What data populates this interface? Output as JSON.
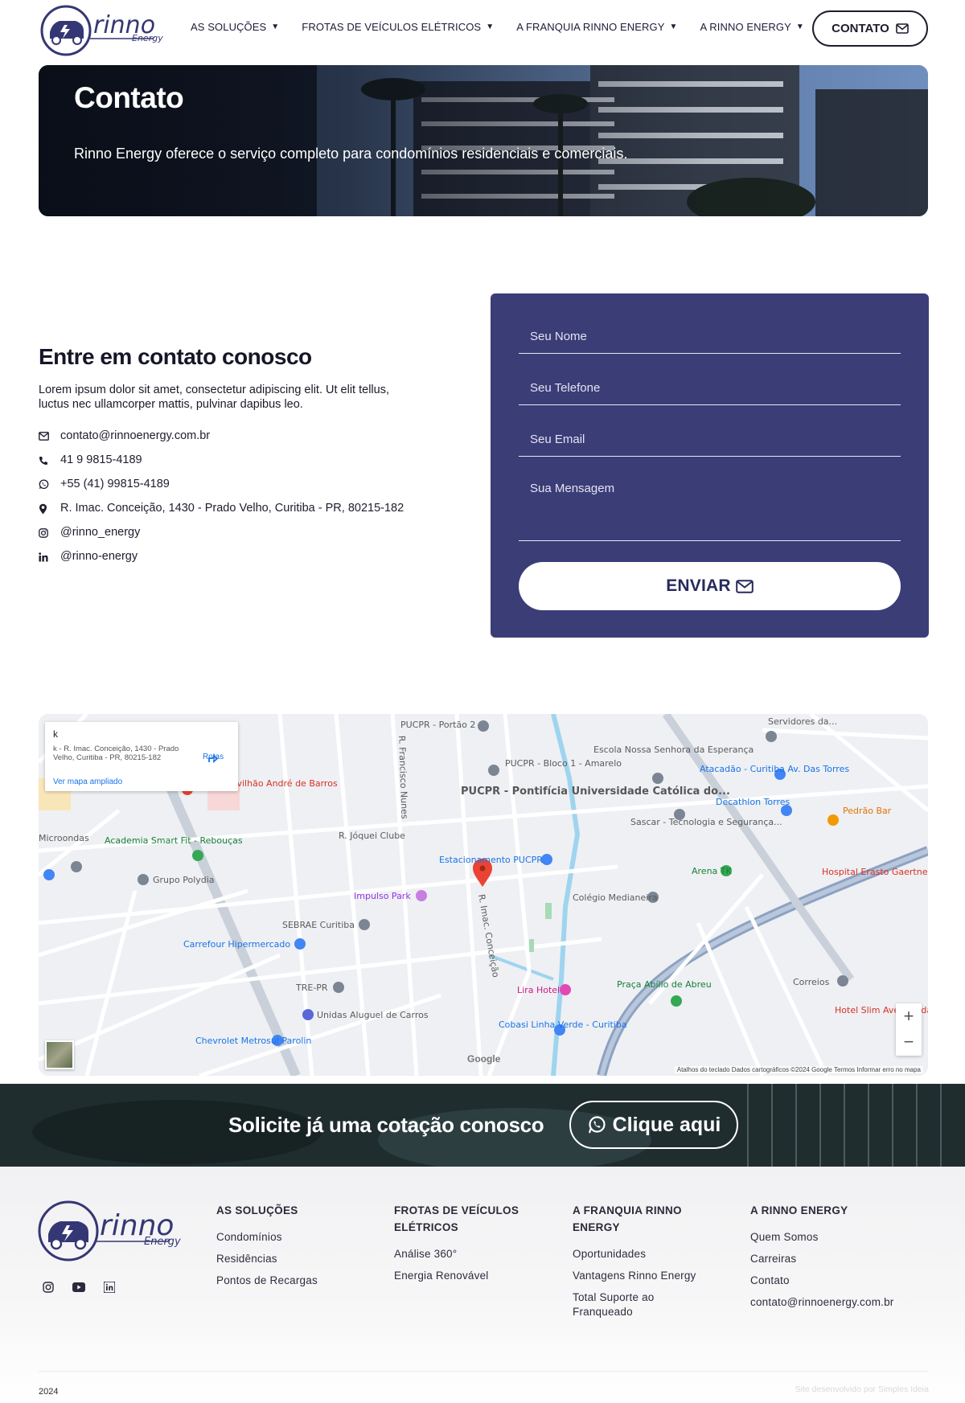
{
  "header": {
    "brand_logo": "rinno energy",
    "nav": [
      {
        "label": "AS SOLUÇÕES"
      },
      {
        "label": "FROTAS DE VEÍCULOS ELÉTRICOS"
      },
      {
        "label": "A FRANQUIA RINNO ENERGY"
      },
      {
        "label": "A RINNO ENERGY"
      }
    ],
    "contact_label": "CONTATO"
  },
  "hero": {
    "title": "Contato",
    "subtitle": "Rinno Energy oferece o serviço completo para condomínios residenciais e comerciais."
  },
  "contact": {
    "heading": "Entre em contato conosco",
    "description": "Lorem ipsum dolor sit amet, consectetur adipiscing elit. Ut elit tellus, luctus nec ullamcorper mattis, pulvinar dapibus leo.",
    "items": [
      {
        "icon": "mail-icon",
        "text": "contato@rinnoenergy.com.br"
      },
      {
        "icon": "phone-icon",
        "text": "41 9 9815-4189"
      },
      {
        "icon": "whatsapp-icon",
        "text": "+55 (41) 99815-4189"
      },
      {
        "icon": "map-pin-icon",
        "text": "R. Imac. Conceição, 1430 - Prado Velho, Curitiba - PR, 80215-182"
      },
      {
        "icon": "instagram-icon",
        "text": "@rinno_energy"
      },
      {
        "icon": "linkedin-icon",
        "text": "@rinno-energy"
      }
    ]
  },
  "form": {
    "name_placeholder": "Seu Nome",
    "phone_placeholder": "Seu Telefone",
    "email_placeholder": "Seu Email",
    "message_placeholder": "Sua Mensagem",
    "submit_label": "ENVIAR"
  },
  "map": {
    "card_title": "k",
    "card_address": "k - R. Imac. Conceição, 1430 - Prado Velho, Curitiba - PR, 80215-182",
    "card_link": "Ver mapa ampliado",
    "card_directions": "Rotas",
    "attribution": "Atalhos do teclado   Dados cartográficos ©2024 Google   Termos   Informar erro no mapa",
    "google": "Google",
    "labels": [
      {
        "text": "PUCPR - Pontifícia Universidade Católica do..."
      },
      {
        "text": "PUCPR - Portão 2"
      },
      {
        "text": "PUCPR - Bloco 1 - Amarelo"
      },
      {
        "text": "Estacionamento PUCPR"
      },
      {
        "text": "Escola Nossa Senhora da Esperança"
      },
      {
        "text": "Atacadão - Curitiba Av. Das Torres"
      },
      {
        "text": "Decathlon Torres"
      },
      {
        "text": "Sascar - Tecnologia e Segurança..."
      },
      {
        "text": "Arena TK"
      },
      {
        "text": "Colégio Medianeira"
      },
      {
        "text": "Pedrão Bar"
      },
      {
        "text": "Hospital Erasto Gaertner"
      },
      {
        "text": "Academia Smart Fit - Rebouças"
      },
      {
        "text": "Grupo Polydia"
      },
      {
        "text": "Microondas"
      },
      {
        "text": "Impulso Park"
      },
      {
        "text": "SEBRAE Curitiba"
      },
      {
        "text": "Carrefour Hipermercado"
      },
      {
        "text": "TRE-PR"
      },
      {
        "text": "Unidas Aluguel de Carros"
      },
      {
        "text": "Lira Hotel"
      },
      {
        "text": "Praça Abílio de Abreu"
      },
      {
        "text": "Correios"
      },
      {
        "text": "Hotel Slim Avenida das..."
      },
      {
        "text": "Cobasi Linha Verde - Curitiba"
      },
      {
        "text": "Chevrolet Metrosul Parolin"
      },
      {
        "text": "tal Pavilhão André de Barros"
      },
      {
        "text": "Servidores da..."
      },
      {
        "text": "R. Jóquei Clube"
      },
      {
        "text": "R. Imac. Conceição"
      },
      {
        "text": "R. Francisco Nunes"
      }
    ]
  },
  "cta": {
    "text": "Solicite já uma cotação conosco",
    "button_label": "Clique aqui"
  },
  "footer": {
    "columns": [
      {
        "title": "AS SOLUÇÕES",
        "links": [
          "Condomínios",
          "Residências",
          "Pontos de Recargas"
        ]
      },
      {
        "title": "FROTAS DE VEÍCULOS ELÉTRICOS",
        "links": [
          "Análise 360°",
          "Energia Renovável"
        ]
      },
      {
        "title": "A FRANQUIA RINNO ENERGY",
        "links": [
          "Oportunidades",
          "Vantagens Rinno Energy",
          "Total Suporte ao Franqueado"
        ]
      },
      {
        "title": "A RINNO ENERGY",
        "links": [
          "Quem Somos",
          "Carreiras",
          "Contato",
          "contato@rinnoenergy.com.br"
        ]
      }
    ],
    "year": "2024",
    "credit": "Site desenvolvido por Simples Ideia"
  },
  "colors": {
    "brand": "#3b3d77",
    "text_dark": "#1c1c2c"
  }
}
